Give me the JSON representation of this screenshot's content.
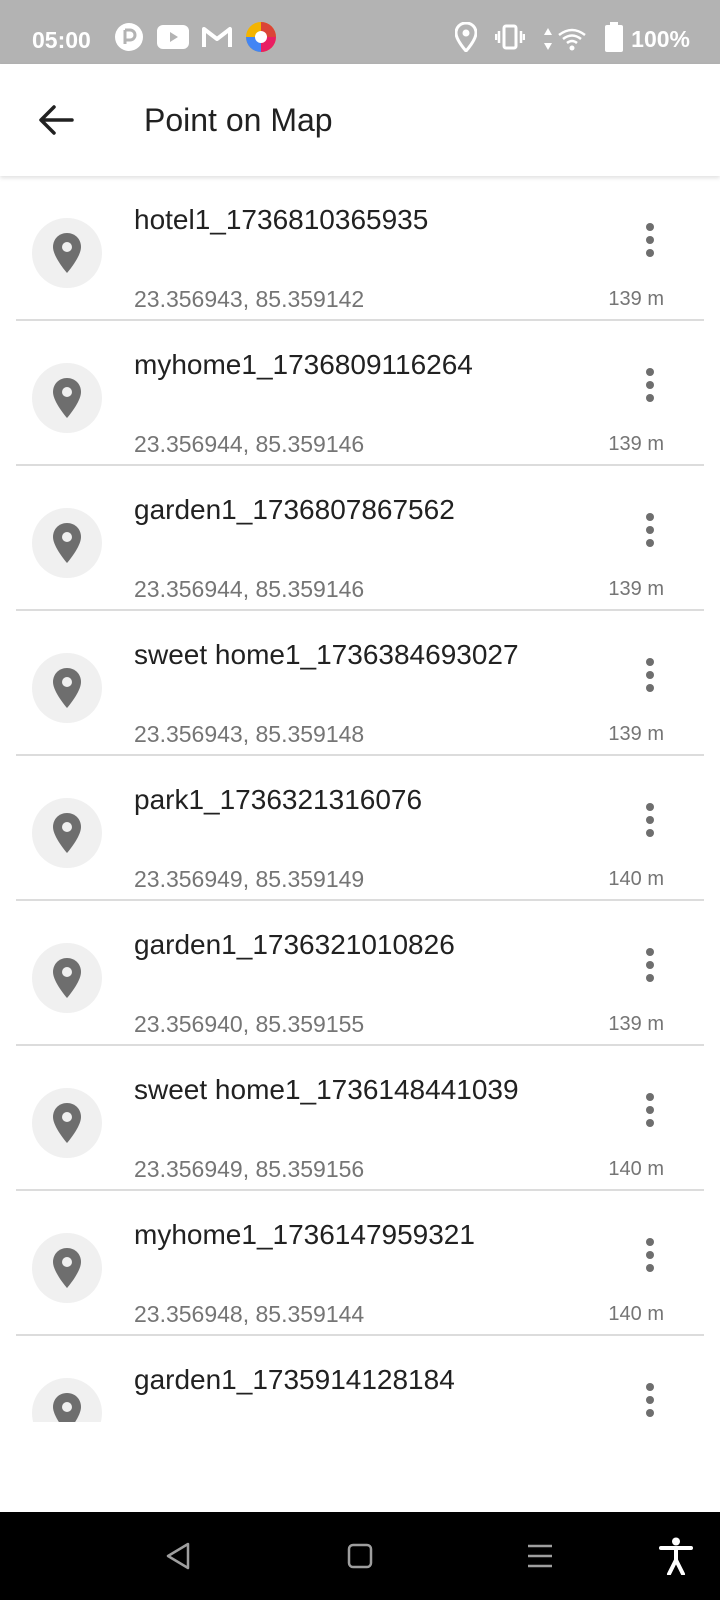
{
  "status_bar": {
    "time": "05:00",
    "battery": "100%",
    "left_icons": [
      "pocket-casts-icon",
      "youtube-icon",
      "gmail-icon",
      "colorful-app-icon"
    ],
    "right_icons": [
      "location-icon",
      "vibrate-icon",
      "data-arrows-icon",
      "wifi-icon",
      "battery-icon"
    ]
  },
  "header": {
    "back_icon": "arrow-back-icon",
    "title": "Point on Map"
  },
  "list": {
    "items": [
      {
        "name": "hotel1_1736810365935",
        "coords": "23.356943, 85.359142",
        "distance": "139 m"
      },
      {
        "name": "myhome1_1736809116264",
        "coords": "23.356944, 85.359146",
        "distance": "139 m"
      },
      {
        "name": "garden1_1736807867562",
        "coords": "23.356944, 85.359146",
        "distance": "139 m"
      },
      {
        "name": "sweet home1_1736384693027",
        "coords": "23.356943, 85.359148",
        "distance": "139 m"
      },
      {
        "name": "park1_1736321316076",
        "coords": "23.356949, 85.359149",
        "distance": "140 m"
      },
      {
        "name": "garden1_1736321010826",
        "coords": "23.356940, 85.359155",
        "distance": "139 m"
      },
      {
        "name": "sweet home1_1736148441039",
        "coords": "23.356949, 85.359156",
        "distance": "140 m"
      },
      {
        "name": "myhome1_1736147959321",
        "coords": "23.356948, 85.359144",
        "distance": "140 m"
      },
      {
        "name": "garden1_1735914128184",
        "coords": "",
        "distance": ""
      }
    ]
  },
  "nav_bar": {
    "buttons": [
      "back-triangle-icon",
      "home-square-icon",
      "recents-lines-icon",
      "accessibility-icon"
    ]
  },
  "colors": {
    "status_bar": "#b3b3b3",
    "avatar_bg": "#f0f0f0",
    "pin": "#6e6e6e",
    "secondary_text": "#757575",
    "divider": "#dcdcdc"
  }
}
